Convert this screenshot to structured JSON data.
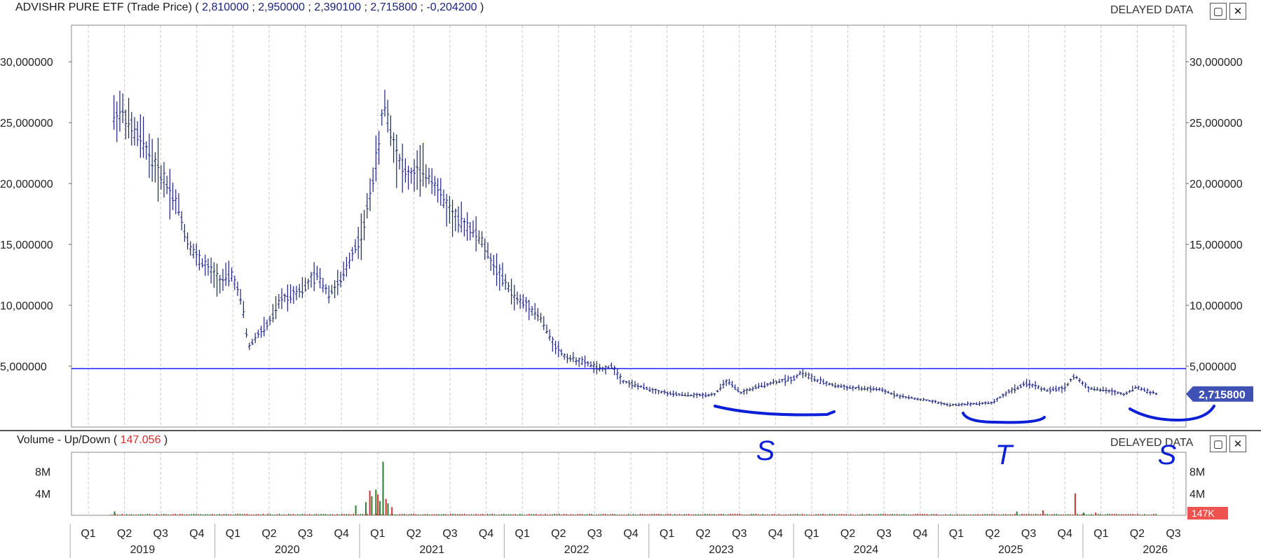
{
  "header": {
    "symbol": "ADVISHR PURE ETF",
    "price_type": "(Trade Price)",
    "open": "2,810000",
    "high": "2,950000",
    "low": "2,390100",
    "close": "2,715800",
    "change": "-0,204200",
    "delayed_label": "DELAYED DATA"
  },
  "volume_header": {
    "title": "Volume - Up/Down",
    "value": "147.056",
    "delayed_label": "DELAYED DATA"
  },
  "window_icons": {
    "maximize": "maximize-icon",
    "close": "close-icon"
  },
  "colors": {
    "price": "#1a237e",
    "hline": "#1a1aff",
    "up": "#2e7d32",
    "down": "#d32f2f",
    "annotation": "#0a1fd6",
    "badge": "#3f51b5",
    "vol_badge": "#ef5350"
  },
  "annotations": {
    "labels": [
      "S",
      "T",
      "S"
    ]
  },
  "chart_data": [
    {
      "type": "ohlc",
      "title": "ADVISHR PURE ETF (Trade Price)",
      "ylim": [
        0,
        33000000
      ],
      "yticks": [
        5000000,
        10000000,
        15000000,
        20000000,
        25000000,
        30000000
      ],
      "ytick_labels": [
        "5,000000",
        "10,000000",
        "15,000000",
        "20,000000",
        "25,000000",
        "30,000000"
      ],
      "horizontal_line": 4800000,
      "last_value_label": "2,715800",
      "grid": "vertical dashed at quarters",
      "x_quarter_labels": [
        "Q1",
        "Q2",
        "Q3",
        "Q4",
        "Q1",
        "Q2",
        "Q3",
        "Q4",
        "Q1",
        "Q2",
        "Q3",
        "Q4",
        "Q1",
        "Q2",
        "Q3",
        "Q4",
        "Q1",
        "Q2",
        "Q3",
        "Q4",
        "Q1",
        "Q2",
        "Q3",
        "Q4",
        "Q1",
        "Q2",
        "Q3",
        "Q4",
        "Q1",
        "Q2",
        "Q3"
      ],
      "x_year_labels": [
        "2019",
        "2020",
        "2021",
        "2022",
        "2023",
        "2024",
        "2025",
        "2026"
      ],
      "x_start_quarter": "2019-Q1",
      "series": [
        {
          "close_path": [
            [
              "2019-04-20",
              25500000
            ],
            [
              "2019-05-10",
              26000000
            ],
            [
              "2019-06-01",
              24500000
            ],
            [
              "2019-07-01",
              23500000
            ],
            [
              "2019-08-01",
              21500000
            ],
            [
              "2019-09-01",
              20000000
            ],
            [
              "2019-10-01",
              18000000
            ],
            [
              "2019-10-20",
              15500000
            ],
            [
              "2019-11-15",
              14000000
            ],
            [
              "2019-12-15",
              13000000
            ],
            [
              "2020-01-15",
              12000000
            ],
            [
              "2020-02-15",
              12500000
            ],
            [
              "2020-03-10",
              10000000
            ],
            [
              "2020-03-25",
              6500000
            ],
            [
              "2020-04-15",
              7500000
            ],
            [
              "2020-05-15",
              8500000
            ],
            [
              "2020-06-15",
              10500000
            ],
            [
              "2020-07-15",
              11000000
            ],
            [
              "2020-08-15",
              11500000
            ],
            [
              "2020-09-15",
              12500000
            ],
            [
              "2020-10-15",
              11000000
            ],
            [
              "2020-11-15",
              12000000
            ],
            [
              "2020-12-15",
              14500000
            ],
            [
              "2021-01-10",
              16000000
            ],
            [
              "2021-02-01",
              20000000
            ],
            [
              "2021-02-20",
              23000000
            ],
            [
              "2021-03-01",
              27000000
            ],
            [
              "2021-03-15",
              25000000
            ],
            [
              "2021-04-01",
              22500000
            ],
            [
              "2021-05-01",
              20500000
            ],
            [
              "2021-06-01",
              21000000
            ],
            [
              "2021-07-01",
              20500000
            ],
            [
              "2021-08-01",
              18500000
            ],
            [
              "2021-09-01",
              17000000
            ],
            [
              "2021-10-01",
              16500000
            ],
            [
              "2021-11-01",
              15500000
            ],
            [
              "2021-12-01",
              13500000
            ],
            [
              "2022-01-01",
              12000000
            ],
            [
              "2022-02-01",
              10500000
            ],
            [
              "2022-03-01",
              10000000
            ],
            [
              "2022-04-01",
              9000000
            ],
            [
              "2022-05-01",
              7000000
            ],
            [
              "2022-06-01",
              5800000
            ],
            [
              "2022-07-01",
              5500000
            ],
            [
              "2022-08-01",
              5200000
            ],
            [
              "2022-09-01",
              4700000
            ],
            [
              "2022-10-01",
              5000000
            ],
            [
              "2022-10-25",
              3800000
            ],
            [
              "2022-12-01",
              3400000
            ],
            [
              "2023-01-15",
              3000000
            ],
            [
              "2023-03-01",
              2700000
            ],
            [
              "2023-05-01",
              2600000
            ],
            [
              "2023-06-15",
              2700000
            ],
            [
              "2023-07-15",
              3800000
            ],
            [
              "2023-08-20",
              2800000
            ],
            [
              "2023-10-01",
              3300000
            ],
            [
              "2023-11-15",
              3700000
            ],
            [
              "2024-01-01",
              4000000
            ],
            [
              "2024-01-20",
              4500000
            ],
            [
              "2024-03-01",
              3800000
            ],
            [
              "2024-04-15",
              3400000
            ],
            [
              "2024-06-01",
              3200000
            ],
            [
              "2024-08-01",
              3100000
            ],
            [
              "2024-10-01",
              2500000
            ],
            [
              "2024-12-01",
              2200000
            ],
            [
              "2025-02-01",
              1800000
            ],
            [
              "2025-03-15",
              1900000
            ],
            [
              "2025-05-15",
              2000000
            ],
            [
              "2025-07-01",
              3000000
            ],
            [
              "2025-08-15",
              3600000
            ],
            [
              "2025-10-01",
              3000000
            ],
            [
              "2025-11-15",
              3200000
            ],
            [
              "2025-12-10",
              4200000
            ],
            [
              "2026-01-15",
              3200000
            ],
            [
              "2026-03-01",
              3000000
            ],
            [
              "2026-04-15",
              2700000
            ],
            [
              "2026-05-15",
              3300000
            ],
            [
              "2026-06-15",
              2900000
            ],
            [
              "2026-07-05",
              2715800
            ]
          ]
        }
      ]
    },
    {
      "type": "bar",
      "title": "Volume - Up/Down",
      "ylim": [
        0,
        10500000
      ],
      "yticks": [
        4000000,
        8000000
      ],
      "ytick_labels": [
        "4M",
        "8M"
      ],
      "last_value_label": "147K",
      "series": [
        {
          "name": "Up",
          "peaks": [
            [
              "2019-04-20",
              700000
            ],
            [
              "2020-12-20",
              1800000
            ],
            [
              "2021-01-15",
              2400000
            ],
            [
              "2021-01-30",
              3500000
            ],
            [
              "2021-02-10",
              4700000
            ],
            [
              "2021-02-20",
              2600000
            ],
            [
              "2021-02-28",
              9800000
            ],
            [
              "2021-03-10",
              2200000
            ],
            [
              "2025-07-15",
              700000
            ],
            [
              "2026-01-01",
              500000
            ]
          ]
        },
        {
          "name": "Down",
          "peaks": [
            [
              "2021-01-25",
              4500000
            ],
            [
              "2021-02-15",
              3800000
            ],
            [
              "2021-03-05",
              3000000
            ],
            [
              "2021-03-20",
              1500000
            ],
            [
              "2025-09-20",
              900000
            ],
            [
              "2025-12-10",
              4000000
            ],
            [
              "2026-02-01",
              500000
            ]
          ]
        }
      ]
    }
  ]
}
